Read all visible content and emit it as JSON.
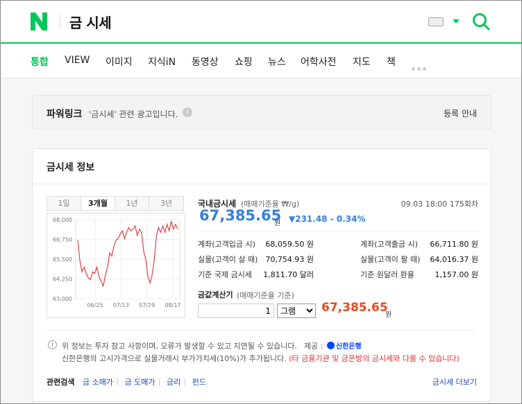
{
  "header": {
    "query": "금 시세"
  },
  "tabs": [
    {
      "label": "통합",
      "active": true
    },
    {
      "label": "VIEW"
    },
    {
      "label": "이미지"
    },
    {
      "label": "지식iN"
    },
    {
      "label": "동영상"
    },
    {
      "label": "쇼핑"
    },
    {
      "label": "뉴스"
    },
    {
      "label": "어학사전"
    },
    {
      "label": "지도"
    },
    {
      "label": "책"
    }
  ],
  "powerlink": {
    "title": "파워링크",
    "desc": "'금시세' 관련 광고입니다.",
    "register": "등록 안내"
  },
  "card": {
    "title": "금시세 정보",
    "period_tabs": [
      "1일",
      "3개월",
      "1년",
      "3년"
    ],
    "active_period": "3개월",
    "domestic": {
      "title": "국내금시세",
      "sub": "(매매기준율 ₩/g)",
      "date": "09.03 18:00 175회차",
      "price": "67,385.65",
      "unit": "원",
      "change": "▼231.48 - 0.34%"
    },
    "rows_left": [
      {
        "label": "계좌(고객입금 시)",
        "value": "68,059.50 원"
      },
      {
        "label": "실물(고객이 살 때)",
        "value": "70,754.93 원"
      },
      {
        "label": "기준 국제 금시세",
        "value": "1,811.70 달러"
      }
    ],
    "rows_right": [
      {
        "label": "계좌(고객출금 시)",
        "value": "66,711.80 원"
      },
      {
        "label": "실물(고객이 팔 때)",
        "value": "64,016.37 원"
      },
      {
        "label": "기준 원달러 환율",
        "value": "1,157.00 원"
      }
    ],
    "calc": {
      "title": "금값계산기",
      "sub": "(매매기준율 기준)",
      "qty": "1",
      "unit_option": "그램",
      "result": "67,385.65",
      "result_unit": "원"
    },
    "notice": {
      "line1": "위 정보는 투자 참고 사항이며, 오류가 발생할 수 있고 지연될 수 있습니다.",
      "provider_label": "제공 :",
      "provider": "신한은행",
      "line2": "신한은행의 고시가격으로 실물거래시 부가가치세(10%)가 추가됩니다.",
      "line2_red": "(타 금융기관 및 금은방의 금시세와 다를 수 있습니다)"
    },
    "related": {
      "title": "관련검색",
      "links": [
        "금 소매가",
        "금 도매가",
        "금리",
        "펀드"
      ],
      "more": "금시세 더보기"
    }
  },
  "chart_data": {
    "type": "line",
    "x_ticks": [
      "06/25",
      "07/13",
      "07/29",
      "08/17"
    ],
    "y_ticks": [
      68000,
      66750,
      65500,
      64250,
      63000
    ],
    "ylim": [
      63000,
      68000
    ],
    "series": [
      {
        "color": "#e04040",
        "values": [
          66700,
          65400,
          64700,
          65000,
          64600,
          64300,
          64200,
          64700,
          64600,
          65000,
          64400,
          64100,
          63800,
          64500,
          65000,
          65900,
          65700,
          66300,
          66700,
          66800,
          67100,
          67300,
          66800,
          67200,
          67500,
          67300,
          67400,
          67600,
          67000,
          67400,
          67200,
          66000,
          65500,
          64400,
          64000,
          64500,
          65500,
          67000,
          67500,
          67200,
          67600,
          67200,
          67700,
          67300,
          67900,
          67400,
          67700,
          67400
        ]
      }
    ]
  }
}
